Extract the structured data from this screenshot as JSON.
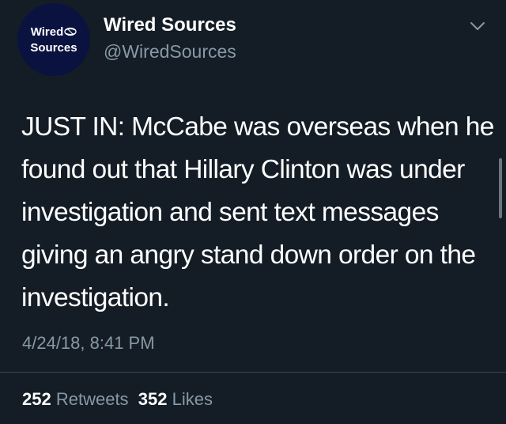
{
  "account": {
    "avatar_line1": "Wired",
    "avatar_line2": "Sources",
    "display_name": "Wired Sources",
    "handle": "@WiredSources"
  },
  "icons": {
    "menu": "chevron-down-icon",
    "avatar_globe": "globe-icon"
  },
  "tweet": {
    "text": "JUST IN: McCabe was overseas when he found out that Hillary Clinton was under investigation and sent text messages giving an angry stand down order on the investigation.",
    "timestamp": "4/24/18, 8:41 PM"
  },
  "stats": {
    "retweets_count": "252",
    "retweets_label": "Retweets",
    "likes_count": "352",
    "likes_label": "Likes"
  },
  "colors": {
    "background": "#141d26",
    "text_primary": "#ffffff",
    "text_secondary": "#8899a6",
    "avatar_bg": "#0a1240",
    "divider": "#38444d"
  }
}
